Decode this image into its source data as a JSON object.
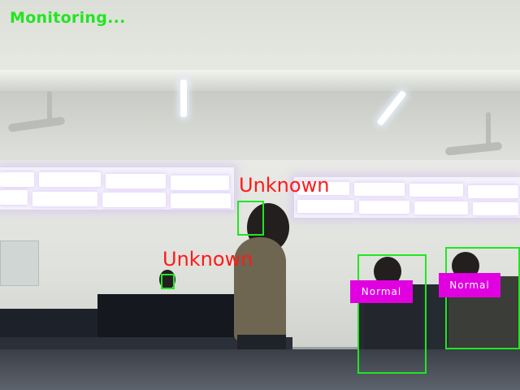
{
  "status": {
    "text": "Monitoring...",
    "color": "#22e522"
  },
  "detections": [
    {
      "label": "Unknown",
      "label_color": "#ff1a1a",
      "box_color": "#22e522"
    },
    {
      "label": "Unknown",
      "label_color": "#ff1a1a",
      "box_color": "#22e522"
    },
    {
      "label": "Normal",
      "label_color": "#ffffff",
      "tag_color": "#e000e0",
      "box_color": "#22e522"
    },
    {
      "label": "Normal",
      "label_color": "#ffffff",
      "tag_color": "#e000e0",
      "box_color": "#22e522"
    }
  ]
}
